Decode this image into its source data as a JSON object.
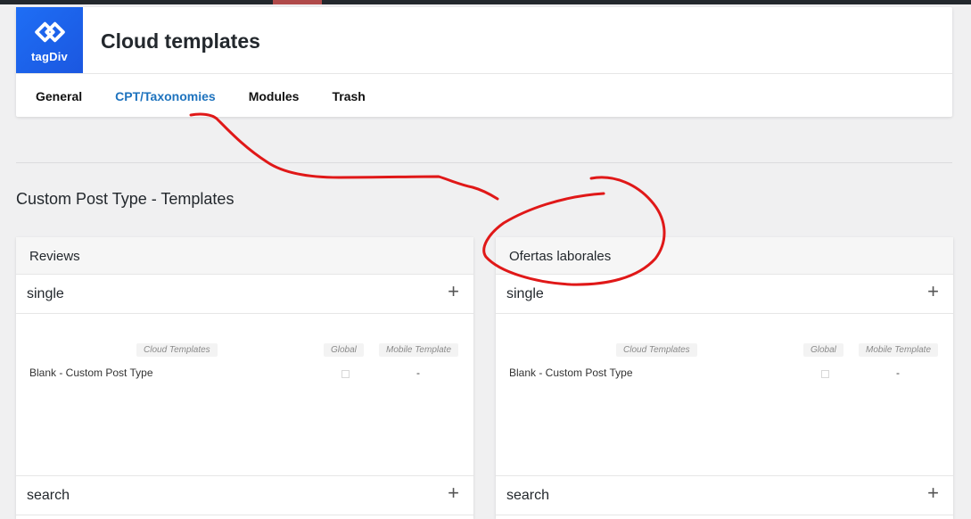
{
  "header": {
    "logo_text": "tagDiv",
    "title": "Cloud templates",
    "brand_color": "#1e6ef5"
  },
  "tabs": [
    {
      "label": "General",
      "active": false
    },
    {
      "label": "CPT/Taxonomies",
      "active": true
    },
    {
      "label": "Modules",
      "active": false
    },
    {
      "label": "Trash",
      "active": false
    }
  ],
  "section": {
    "title": "Custom Post Type - Templates"
  },
  "panels": [
    {
      "title": "Reviews",
      "rows": [
        {
          "label": "single",
          "columns": {
            "cloud": "Cloud Templates",
            "global": "Global",
            "mobile": "Mobile Template"
          },
          "template": {
            "name": "Blank - Custom Post Type",
            "mobile": "-"
          }
        },
        {
          "label": "search"
        }
      ]
    },
    {
      "title": "Ofertas laborales",
      "rows": [
        {
          "label": "single",
          "columns": {
            "cloud": "Cloud Templates",
            "global": "Global",
            "mobile": "Mobile Template"
          },
          "template": {
            "name": "Blank - Custom Post Type",
            "mobile": "-"
          }
        },
        {
          "label": "search"
        }
      ]
    }
  ],
  "plus_glyph": "+",
  "annotation_color": "#e01818"
}
